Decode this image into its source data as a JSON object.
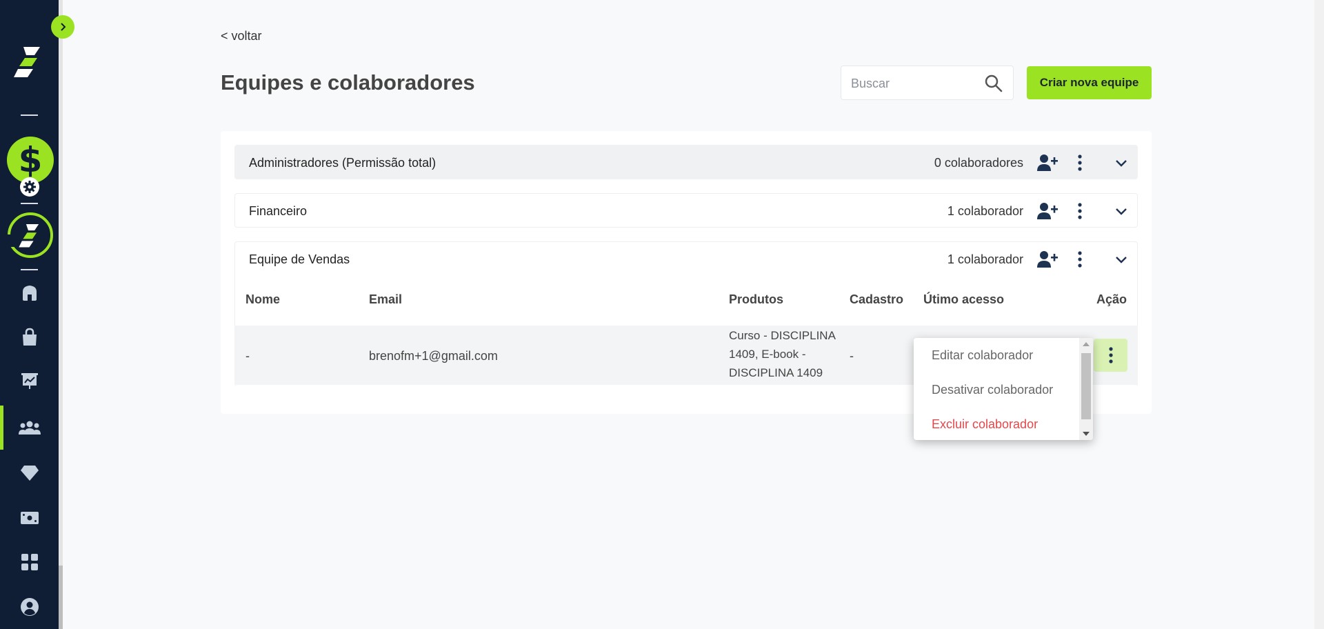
{
  "nav": {
    "back_label": "< voltar",
    "items": [
      "home",
      "products",
      "dashboard",
      "team",
      "diamond",
      "cash",
      "apps",
      "profile"
    ],
    "active": "team"
  },
  "page": {
    "title": "Equipes e colaboradores"
  },
  "search": {
    "placeholder": "Buscar",
    "value": ""
  },
  "actions": {
    "create_team_label": "Criar nova equipe"
  },
  "teams": [
    {
      "name": "Administradores (Permissão total)",
      "count": "0 colaboradores",
      "expanded": false
    },
    {
      "name": "Financeiro",
      "count": "1 colaborador",
      "expanded": false
    },
    {
      "name": "Equipe de Vendas",
      "count": "1 colaborador",
      "expanded": true
    }
  ],
  "members_table": {
    "headers": [
      "Nome",
      "Email",
      "Produtos",
      "Cadastro",
      "Útimo acesso",
      "Ação"
    ],
    "rows": [
      {
        "name": "-",
        "email": "brenofm+1@gmail.com",
        "products": "Curso - DISCIPLINA 1409, E-book - DISCIPLINA 1409",
        "registered": "-",
        "last_access": ""
      }
    ]
  },
  "action_menu": {
    "items": [
      "Editar colaborador",
      "Desativar colaborador",
      "Excluir colaborador"
    ]
  },
  "colors": {
    "accent": "#9be223",
    "sidebar_bg": "#0f1e34",
    "danger": "#e2474a",
    "icon": "#1e3352"
  }
}
